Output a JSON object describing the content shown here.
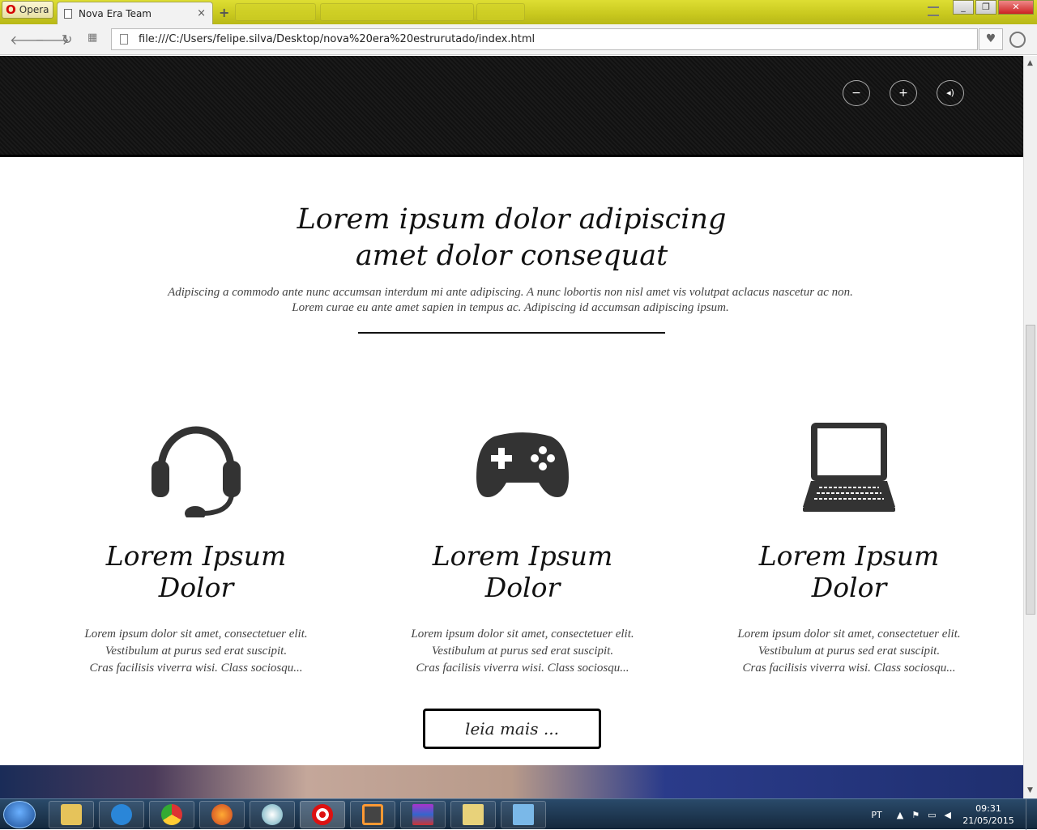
{
  "browser": {
    "menu_label": "Opera",
    "tab_title": "Nova Era Team",
    "tab_close": "×",
    "new_tab": "+",
    "url": "file:///C:/Users/felipe.silva/Desktop/nova%20era%20estrurutado/index.html"
  },
  "hero": {
    "controls": [
      "−",
      "+",
      "◂)"
    ]
  },
  "intro": {
    "title_line1": "Lorem ipsum dolor adipiscing",
    "title_line2": "amet dolor consequat",
    "text_line1": "Adipiscing a commodo ante nunc accumsan interdum mi ante adipiscing. A nunc lobortis non nisl amet vis volutpat aclacus nascetur ac non.",
    "text_line2": "Lorem curae eu ante amet sapien in tempus ac. Adipiscing id accumsan adipiscing ipsum."
  },
  "features": [
    {
      "icon": "headset-icon",
      "title": "Lorem Ipsum Dolor",
      "line1": "Lorem ipsum dolor sit amet, consectetuer elit.",
      "line2": "Vestibulum at purus sed erat suscipit.",
      "line3": "Cras facilisis viverra wisi. Class sociosqu..."
    },
    {
      "icon": "gamepad-icon",
      "title": "Lorem Ipsum Dolor",
      "line1": "Lorem ipsum dolor sit amet, consectetuer elit.",
      "line2": "Vestibulum at purus sed erat suscipit.",
      "line3": "Cras facilisis viverra wisi. Class sociosqu..."
    },
    {
      "icon": "laptop-icon",
      "title": "Lorem Ipsum Dolor",
      "line1": "Lorem ipsum dolor sit amet, consectetuer elit.",
      "line2": "Vestibulum at purus sed erat suscipit.",
      "line3": "Cras facilisis viverra wisi. Class sociosqu..."
    }
  ],
  "readmore_label": "leia mais ...",
  "taskbar": {
    "language": "PT",
    "time": "09:31",
    "date": "21/05/2015"
  }
}
